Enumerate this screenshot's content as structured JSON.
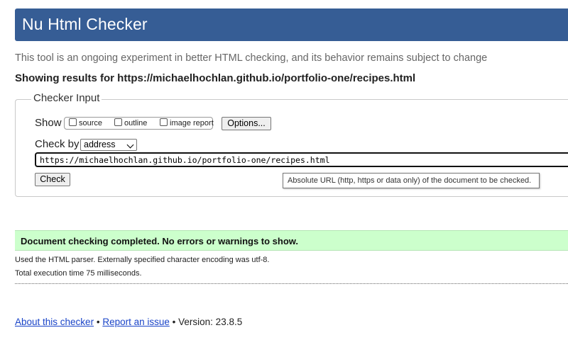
{
  "header": {
    "title": "Nu Html Checker"
  },
  "tagline": "This tool is an ongoing experiment in better HTML checking, and its behavior remains subject to change",
  "showing": "Showing results for https://michaelhochlan.github.io/portfolio-one/recipes.html",
  "checker_input": {
    "legend": "Checker Input",
    "show_label": "Show",
    "checkboxes": [
      {
        "label": "source",
        "checked": false
      },
      {
        "label": "outline",
        "checked": false
      },
      {
        "label": "image report",
        "checked": false
      }
    ],
    "options_button": "Options...",
    "check_by_label": "Check by",
    "check_by_value": "address",
    "url_value": "https://michaelhochlan.github.io/portfolio-one/recipes.html",
    "check_button": "Check",
    "tooltip": "Absolute URL (http, https or data only) of the document to be checked."
  },
  "results": {
    "success_message": "Document checking completed. No errors or warnings to show.",
    "parser_info": "Used the HTML parser. Externally specified character encoding was utf-8.",
    "execution_time": "Total execution time 75 milliseconds."
  },
  "footer": {
    "about_link": "About this checker",
    "separator": "•",
    "report_link": "Report an issue",
    "version": "Version: 23.8.5"
  },
  "colors": {
    "header_bg": "#365d95",
    "success_bg": "#ccffcc",
    "link": "#1a44c8"
  }
}
